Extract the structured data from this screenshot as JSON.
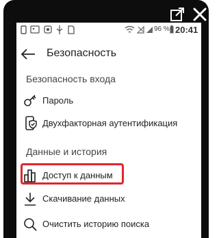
{
  "status_bar": {
    "battery_percent": "96 %",
    "time": "20:41",
    "icons": [
      "phone-icon",
      "image-icon",
      "radio-icon",
      "usb-icon",
      "sim-icon",
      "wifi-icon",
      "no-signal-icon",
      "signal-icon",
      "battery-icon"
    ]
  },
  "header": {
    "title": "Безопасность"
  },
  "sections": [
    {
      "title": "Безопасность входа",
      "items": [
        {
          "label": "Пароль",
          "icon": "key-icon"
        },
        {
          "label": "Двухфакторная аутентификация",
          "icon": "phone-shield-icon"
        }
      ]
    },
    {
      "title": "Данные и история",
      "items": [
        {
          "label": "Доступ к данным",
          "icon": "bar-chart-icon",
          "highlighted": true
        },
        {
          "label": "Скачивание данных",
          "icon": "download-icon"
        },
        {
          "label": "Очистить историю поиска",
          "icon": "search-icon"
        }
      ]
    }
  ],
  "colors": {
    "highlight": "#e0262b",
    "device_bezel": "#0d0d0d",
    "text": "#222222"
  }
}
